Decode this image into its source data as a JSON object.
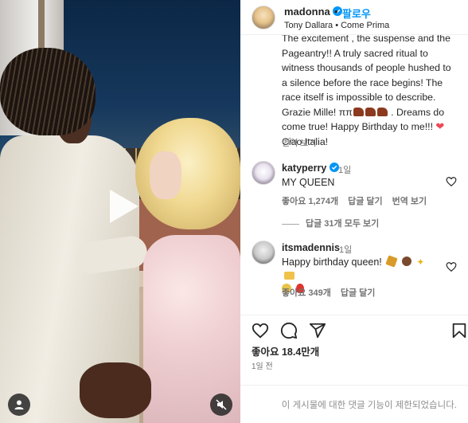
{
  "post": {
    "username": "madonna",
    "follow_label": "팔로우",
    "dot": "•",
    "subtitle": "Tony Dallara • Come Prima"
  },
  "caption": {
    "line1": "The excitement , the suspense and the",
    "line2": "Pageantry!! A truly sacred ritual to",
    "line3": "witness  thousands of people hushed to",
    "line4": "a silence before the race begins!  The",
    "line5": "race itself is impossible to describe.",
    "line6_a": "Grazie Mille! ",
    "line6_pi": "ππ",
    "line6_b": " . Dreams do",
    "line7_a": "come true! Happy Birthday to me!!! ",
    "line7_heart": "❤",
    "line8": "Ciao Italia!",
    "translate_label": "번역 보기"
  },
  "comments": [
    {
      "username": "katyperry",
      "time": "1일",
      "text": "MY QUEEN",
      "likes": "좋아요 1,274개",
      "reply": "답글 달기",
      "translate": "번역 보기",
      "view_replies": "답글 31개 모두 보기"
    },
    {
      "username": "itsmadennis",
      "time": "1일",
      "text": "Happy birthday queen!",
      "likes": "좋아요 349개",
      "reply": "답글 달기"
    }
  ],
  "stats": {
    "likes": "좋아요 18.4만개",
    "posted": "1일 전"
  },
  "footer": {
    "restricted": "이 게시물에 대한 댓글 기능이 제한되었습니다."
  },
  "colors": {
    "accent": "#0095f6",
    "verified": "#0095f6",
    "heart": "#ed4956",
    "muted": "#737373"
  },
  "icons": [
    "verified-icon",
    "play-icon",
    "user-tag-icon",
    "mute-icon",
    "heart-icon",
    "comment-icon",
    "share-icon",
    "save-icon"
  ]
}
